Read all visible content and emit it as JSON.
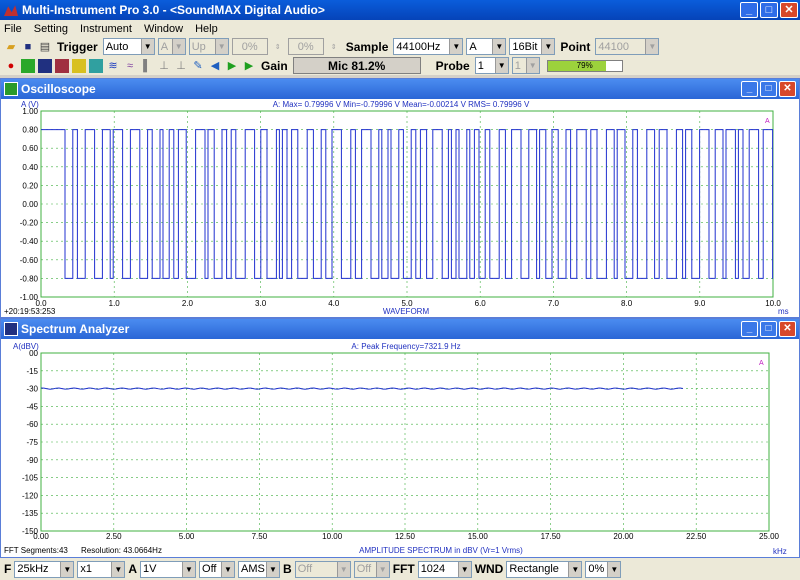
{
  "window": {
    "title": "Multi-Instrument Pro 3.0 - <SoundMAX Digital Audio>"
  },
  "menu": [
    "File",
    "Setting",
    "Instrument",
    "Window",
    "Help"
  ],
  "toolbar1": {
    "trigger_label": "Trigger",
    "trigger_mode": "Auto",
    "channel": "A",
    "edge": "Up",
    "level1": "0%",
    "level2": "0%",
    "sample_label": "Sample",
    "sample_rate": "44100Hz",
    "sample_channel": "A",
    "bit_depth": "16Bit",
    "point_label": "Point",
    "point_value": "44100"
  },
  "toolbar2": {
    "gain_label": "Gain",
    "mic_level": "Mic 81.2%",
    "probe_label": "Probe",
    "probe_value": "1",
    "probe_value2": "1",
    "level_text": "79%",
    "level_fraction": 0.79
  },
  "oscilloscope": {
    "title": "Oscilloscope",
    "y_unit": "A (V)",
    "stats": "A: Max= 0.79996 V  Min=-0.79996 V  Mean=-0.00214 V  RMS= 0.79996 V",
    "timestamp": "+20:19:53:253",
    "xlabel": "WAVEFORM",
    "xunit": "ms",
    "yticks": [
      "1.00",
      "0.80",
      "0.60",
      "0.40",
      "0.20",
      "0.00",
      "-0.20",
      "-0.40",
      "-0.60",
      "-0.80",
      "-1.00"
    ],
    "xticks": [
      "0.0",
      "1.0",
      "2.0",
      "3.0",
      "4.0",
      "5.0",
      "6.0",
      "7.0",
      "8.0",
      "9.0",
      "10.0"
    ],
    "legend": "A"
  },
  "spectrum": {
    "title": "Spectrum Analyzer",
    "y_unit": "A(dBV)",
    "stats": "A: Peak Frequency=7321.9 Hz",
    "fft_segments": "FFT Segments:43",
    "resolution": "Resolution: 43.0664Hz",
    "xlabel": "AMPLITUDE SPECTRUM in dBV (Vr=1 Vrms)",
    "xunit": "kHz",
    "yticks": [
      "00",
      "-15",
      "-30",
      "-45",
      "-60",
      "-75",
      "-90",
      "-105",
      "-120",
      "-135",
      "-150"
    ],
    "xticks": [
      "0.00",
      "2.50",
      "5.00",
      "7.50",
      "10.00",
      "12.50",
      "15.00",
      "17.50",
      "20.00",
      "22.50",
      "25.00"
    ],
    "legend": "A"
  },
  "statusbar": {
    "f_label": "F",
    "freq_range": "25kHz",
    "mult": "x1",
    "a_label": "A",
    "a_scale": "1V",
    "a_off": "Off",
    "ams": "AMS",
    "b_label": "B",
    "b_off": "Off",
    "b_off2": "Off",
    "fft_label": "FFT",
    "fft_size": "1024",
    "wnd_label": "WND",
    "window_fn": "Rectangle",
    "overlap": "0%"
  },
  "chart_data": [
    {
      "type": "line",
      "title": "",
      "xlabel": "WAVEFORM",
      "ylabel": "A (V)",
      "xlim": [
        0,
        10
      ],
      "ylim": [
        -1,
        1
      ],
      "series": [
        {
          "name": "A",
          "description_values": {
            "high": 0.8,
            "low": -0.8
          }
        }
      ]
    },
    {
      "type": "line",
      "title": "",
      "xlabel": "AMPLITUDE SPECTRUM in dBV (Vr=1 Vrms)",
      "ylabel": "A(dBV)",
      "xlim": [
        0,
        25
      ],
      "ylim": [
        -150,
        0
      ],
      "series": [
        {
          "name": "A",
          "x": [
            0,
            22.05
          ],
          "values": [
            -30,
            -30
          ]
        }
      ]
    }
  ]
}
